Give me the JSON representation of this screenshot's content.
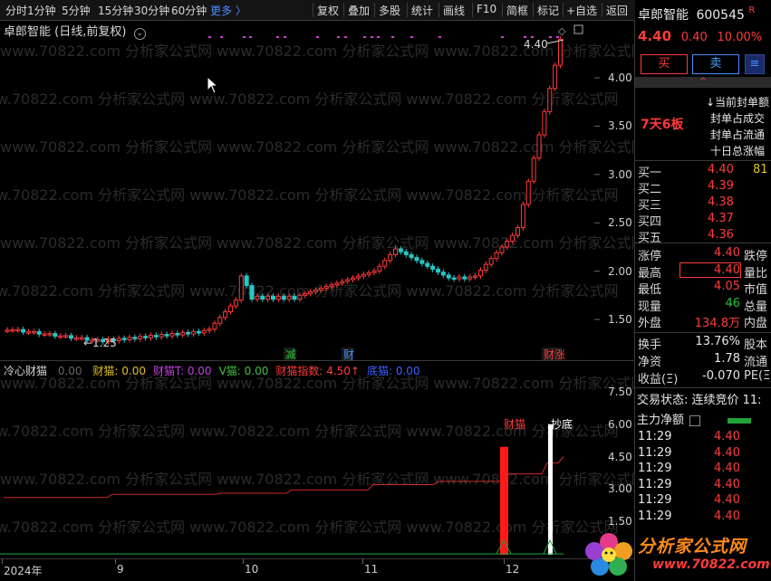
{
  "toolbar": {
    "items": [
      "分时",
      "1分钟",
      "5分钟",
      "15分钟",
      "30分钟",
      "60分钟",
      "更多 〉",
      "复权",
      "叠加",
      "多股",
      "统计",
      "画线",
      "F10",
      "简框",
      "标记",
      "+自选",
      "返回"
    ]
  },
  "chart_header": {
    "title": "卓郎智能 (日线,前复权)",
    "tag": "◇",
    "peak_label": "4.40"
  },
  "price_axis": [
    "4.00",
    "3.50",
    "3.00",
    "2.50",
    "2.00",
    "1.50"
  ],
  "low_label": "1.25",
  "signals": {
    "jian": "减",
    "cai": "财",
    "cai_zhang": "财涨"
  },
  "watermark": "www.70822.com 分析家公式网",
  "indicator": {
    "name": "冷心财猫",
    "value0": "0.00",
    "fields": [
      {
        "label": "财猫: 0.00",
        "color": "#e0c020"
      },
      {
        "label": "财猫T: 0.00",
        "color": "#c040e0"
      },
      {
        "label": "V猫: 0.00",
        "color": "#40c040"
      },
      {
        "label": "财猫指数: 4.50↑",
        "color": "#ff3b3b"
      },
      {
        "label": "底猫: 0.00",
        "color": "#4060ff"
      }
    ],
    "axis": [
      "7.50",
      "6.00",
      "4.50",
      "3.00",
      "1.50"
    ],
    "bar_labels": {
      "red": "财猫",
      "white": "抄底"
    }
  },
  "date_axis": [
    "2024年",
    "9",
    "10",
    "11",
    "12"
  ],
  "right_panel": {
    "stock_name": "卓郎智能",
    "code": "600545",
    "r_badge": "R",
    "price": "4.40",
    "change": "0.40",
    "pct": "10.00%",
    "buy_label": "买",
    "sell_label": "卖",
    "collapse": "^",
    "limit_info": [
      {
        "label": "当前封单额",
        "prefix": "↓"
      },
      {
        "label": "封单占成交",
        "prefix": ""
      },
      {
        "label": "封单占流通",
        "prefix": ""
      },
      {
        "label": "十日总涨幅",
        "prefix": ""
      }
    ],
    "streak": "7天6板",
    "bids": [
      {
        "label": "买一",
        "price": "4.40",
        "vol": "81"
      },
      {
        "label": "买二",
        "price": "4.39",
        "vol": ""
      },
      {
        "label": "买三",
        "price": "4.38",
        "vol": ""
      },
      {
        "label": "买四",
        "price": "4.37",
        "vol": ""
      },
      {
        "label": "买五",
        "price": "4.36",
        "vol": ""
      }
    ],
    "stats": [
      {
        "l": "涨停",
        "v": "4.40",
        "c": "#ff3b3b",
        "r": "跌停"
      },
      {
        "l": "最高",
        "v": "4.40",
        "c": "#ff3b3b",
        "r": "量比"
      },
      {
        "l": "最低",
        "v": "4.05",
        "c": "#ff3b3b",
        "r": "市值"
      },
      {
        "l": "现量",
        "v": "46",
        "c": "#22c53a",
        "r": "总量"
      },
      {
        "l": "外盘",
        "v": "134.8万",
        "c": "#ff3b3b",
        "r": "内盘"
      }
    ],
    "stats2": [
      {
        "l": "换手",
        "v": "13.76%",
        "r": "股本"
      },
      {
        "l": "净资",
        "v": "1.78",
        "r": "流通"
      },
      {
        "l": "收益(Ξ)",
        "v": "-0.070",
        "r": "PE(Ξ"
      }
    ],
    "trade_status": "交易状态: 连续竞价 11:",
    "main_flow": "主力净额",
    "ticks": [
      {
        "t": "11:29",
        "p": "4.40"
      },
      {
        "t": "11:29",
        "p": "4.40"
      },
      {
        "t": "11:29",
        "p": "4.40"
      },
      {
        "t": "11:29",
        "p": "4.40"
      },
      {
        "t": "11:29",
        "p": "4.40"
      },
      {
        "t": "11:29",
        "p": "4.40"
      }
    ]
  },
  "logo": {
    "text": "分析家公式网",
    "url": "www.70822.com"
  }
}
